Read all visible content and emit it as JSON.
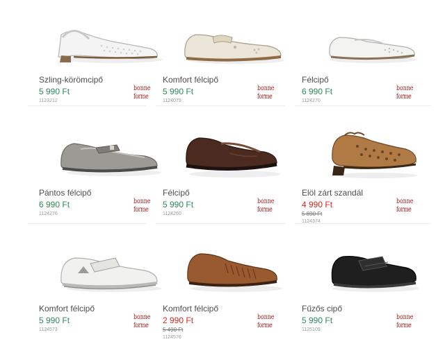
{
  "products": [
    {
      "name": "Szling-körömcipő",
      "price": "5 990 Ft",
      "old_price": "",
      "code": "1123212",
      "logo": "bonne forme",
      "image_icon": "white-slingback-shoe-icon"
    },
    {
      "name": "Komfort félcipő",
      "price": "5 990 Ft",
      "old_price": "",
      "code": "1124079",
      "logo": "bonne forme",
      "image_icon": "cream-strap-shoe-icon"
    },
    {
      "name": "Félcipő",
      "price": "6 990 Ft",
      "old_price": "",
      "code": "1124270",
      "logo": "bonne forme",
      "image_icon": "white-perforated-loafer-icon"
    },
    {
      "name": "Pántos félcipő",
      "price": "6 990 Ft",
      "old_price": "",
      "code": "1124276",
      "logo": "bonne forme",
      "image_icon": "grey-strap-shoe-icon"
    },
    {
      "name": "Félcipő",
      "price": "5 990 Ft",
      "old_price": "",
      "code": "1124260",
      "logo": "bonne forme",
      "image_icon": "brown-leather-loafer-icon"
    },
    {
      "name": "Elöl zárt szandál",
      "price": "4 990 Ft",
      "old_price": "5 890 Ft",
      "code": "1124374",
      "logo": "bonne forme",
      "image_icon": "tan-closed-toe-sandal-icon"
    },
    {
      "name": "Komfort félcipő",
      "price": "5 990 Ft",
      "old_price": "",
      "code": "1124573",
      "logo": "bonne forme",
      "image_icon": "white-velcro-shoe-icon"
    },
    {
      "name": "Komfort félcipő",
      "price": "2 990 Ft",
      "old_price": "5 490 Ft",
      "code": "1124576",
      "logo": "bonne forme",
      "image_icon": "brown-woven-loafer-icon"
    },
    {
      "name": "Fűzős cipő",
      "price": "5 990 Ft",
      "old_price": "",
      "code": "1125109",
      "logo": "bonne forme",
      "image_icon": "black-strap-shoe-icon"
    }
  ],
  "colors": {
    "price_normal": "#2e8b57",
    "price_sale": "#d6281f",
    "logo": "#a01e1e",
    "name": "#4d4d4d"
  }
}
